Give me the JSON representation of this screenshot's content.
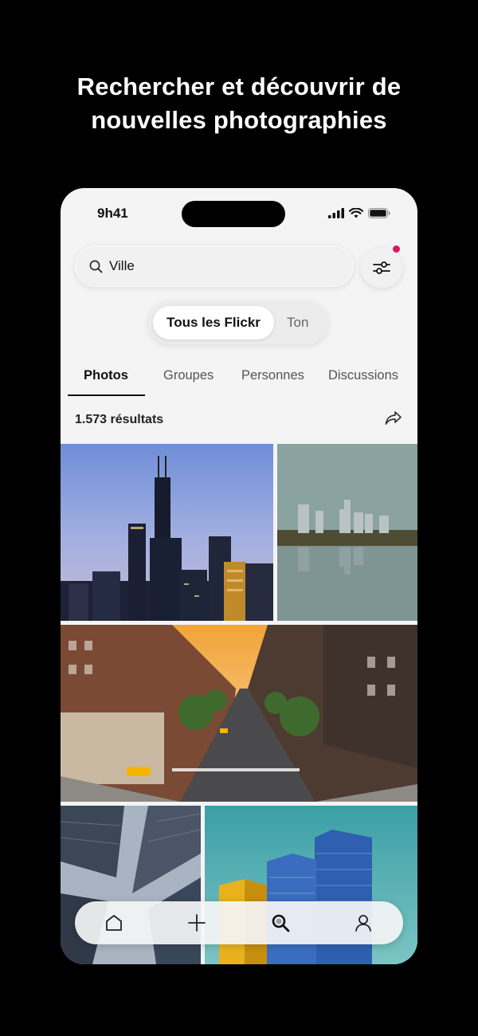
{
  "headline": {
    "line1": "Rechercher et découvrir de",
    "line2": "nouvelles photographies"
  },
  "status_bar": {
    "time": "9h41"
  },
  "search": {
    "value": "Ville",
    "placeholder": ""
  },
  "filter": {
    "has_notification": true,
    "dot_color": "#e0155f"
  },
  "scope": {
    "active_label": "Tous les Flickr",
    "other_label": "Ton"
  },
  "tabs": [
    {
      "label": "Photos",
      "active": true
    },
    {
      "label": "Groupes",
      "active": false
    },
    {
      "label": "Personnes",
      "active": false
    },
    {
      "label": "Discussions",
      "active": false
    }
  ],
  "results": {
    "count_label": "1.573 résultats"
  },
  "photos": [
    {
      "subject": "skyscraper skyline at dusk"
    },
    {
      "subject": "city skyline reflected in river"
    },
    {
      "subject": "city street avenue at sunset"
    },
    {
      "subject": "looking up at glass towers"
    },
    {
      "subject": "blue glass towers and yellow building"
    }
  ],
  "bottom_nav": [
    {
      "icon": "home-icon"
    },
    {
      "icon": "plus-icon"
    },
    {
      "icon": "search-icon",
      "active": true
    },
    {
      "icon": "profile-icon"
    }
  ]
}
